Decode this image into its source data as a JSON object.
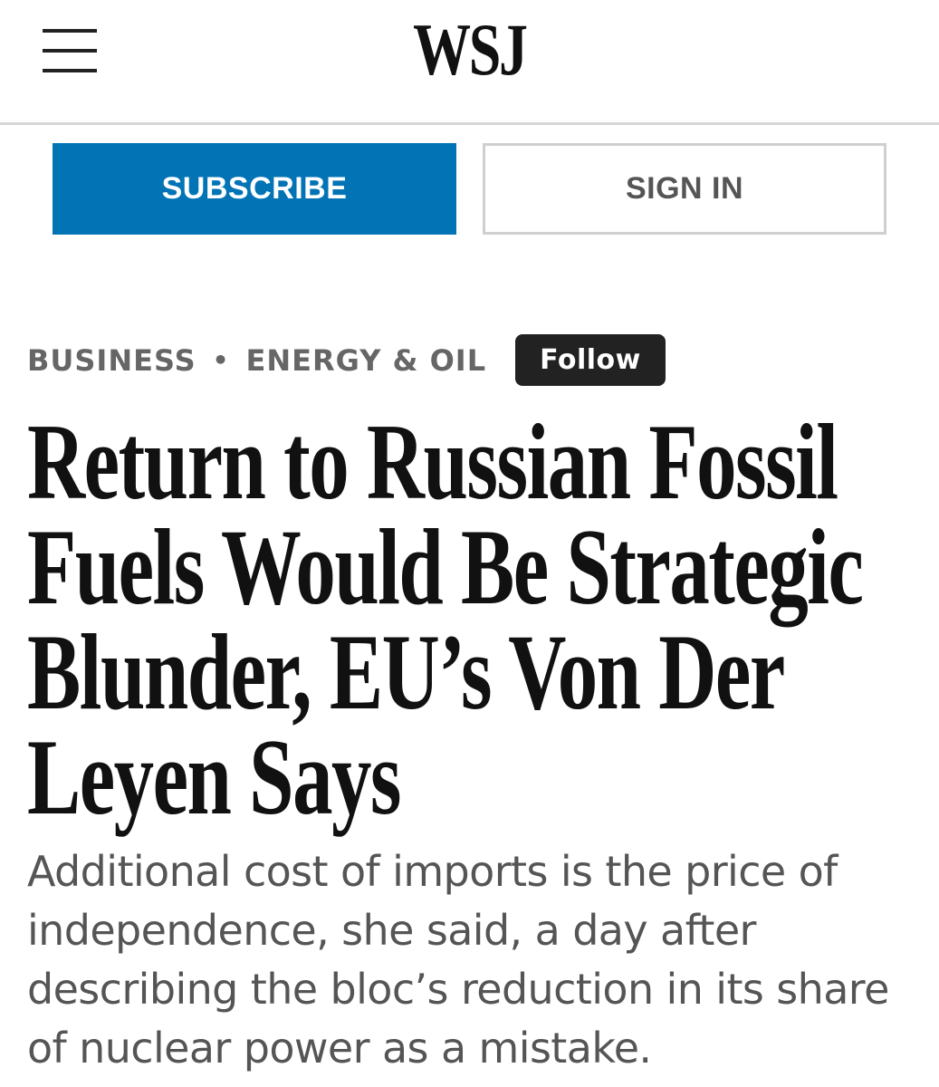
{
  "header": {
    "menu_icon": "hamburger-menu-icon",
    "logo_text": "WSJ"
  },
  "auth": {
    "subscribe_label": "SUBSCRIBE",
    "signin_label": "SIGN IN",
    "subscribe_color": "#0274b6"
  },
  "breadcrumb": {
    "section": "BUSINESS",
    "separator": "•",
    "subsection": "ENERGY & OIL",
    "follow_label": "Follow"
  },
  "article": {
    "headline_lines": [
      "Return to Russian Fossil",
      "Fuels Would Be Strategic",
      "Blunder, EU’s Von Der",
      "Leyen Says"
    ],
    "dek_lines": [
      "Additional cost of imports is the price of",
      "independence, she said, a day after",
      "describing the bloc’s reduction in its share",
      "of nuclear power as a mistake."
    ]
  }
}
